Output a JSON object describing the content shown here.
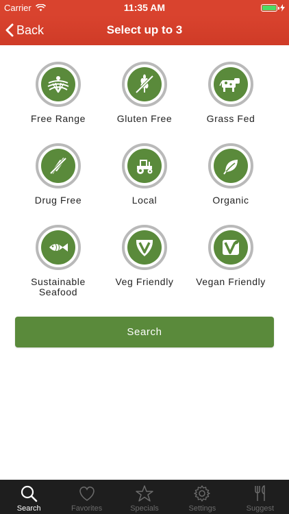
{
  "status": {
    "carrier": "Carrier",
    "time": "11:35 AM"
  },
  "nav": {
    "back": "Back",
    "title": "Select up to 3"
  },
  "filters": [
    {
      "label": "Free Range",
      "icon": "field-icon"
    },
    {
      "label": "Gluten Free",
      "icon": "wheat-crossed-icon"
    },
    {
      "label": "Grass Fed",
      "icon": "cow-icon"
    },
    {
      "label": "Drug Free",
      "icon": "syringe-crossed-icon"
    },
    {
      "label": "Local",
      "icon": "tractor-icon"
    },
    {
      "label": "Organic",
      "icon": "leaf-icon"
    },
    {
      "label": "Sustainable Seafood",
      "icon": "fish-icon"
    },
    {
      "label": "Veg Friendly",
      "icon": "v-badge-icon"
    },
    {
      "label": "Vegan Friendly",
      "icon": "v-leaf-icon"
    }
  ],
  "search_button": "Search",
  "tabs": [
    {
      "label": "Search",
      "icon": "search-icon",
      "active": true
    },
    {
      "label": "Favorites",
      "icon": "heart-icon",
      "active": false
    },
    {
      "label": "Specials",
      "icon": "star-icon",
      "active": false
    },
    {
      "label": "Settings",
      "icon": "gear-icon",
      "active": false
    },
    {
      "label": "Suggest",
      "icon": "fork-knife-icon",
      "active": false
    }
  ],
  "colors": {
    "header": "#d9432e",
    "accent_green": "#5a8a3b",
    "ring_gray": "#b9b9b9",
    "tabbar": "#1e1e1e"
  }
}
